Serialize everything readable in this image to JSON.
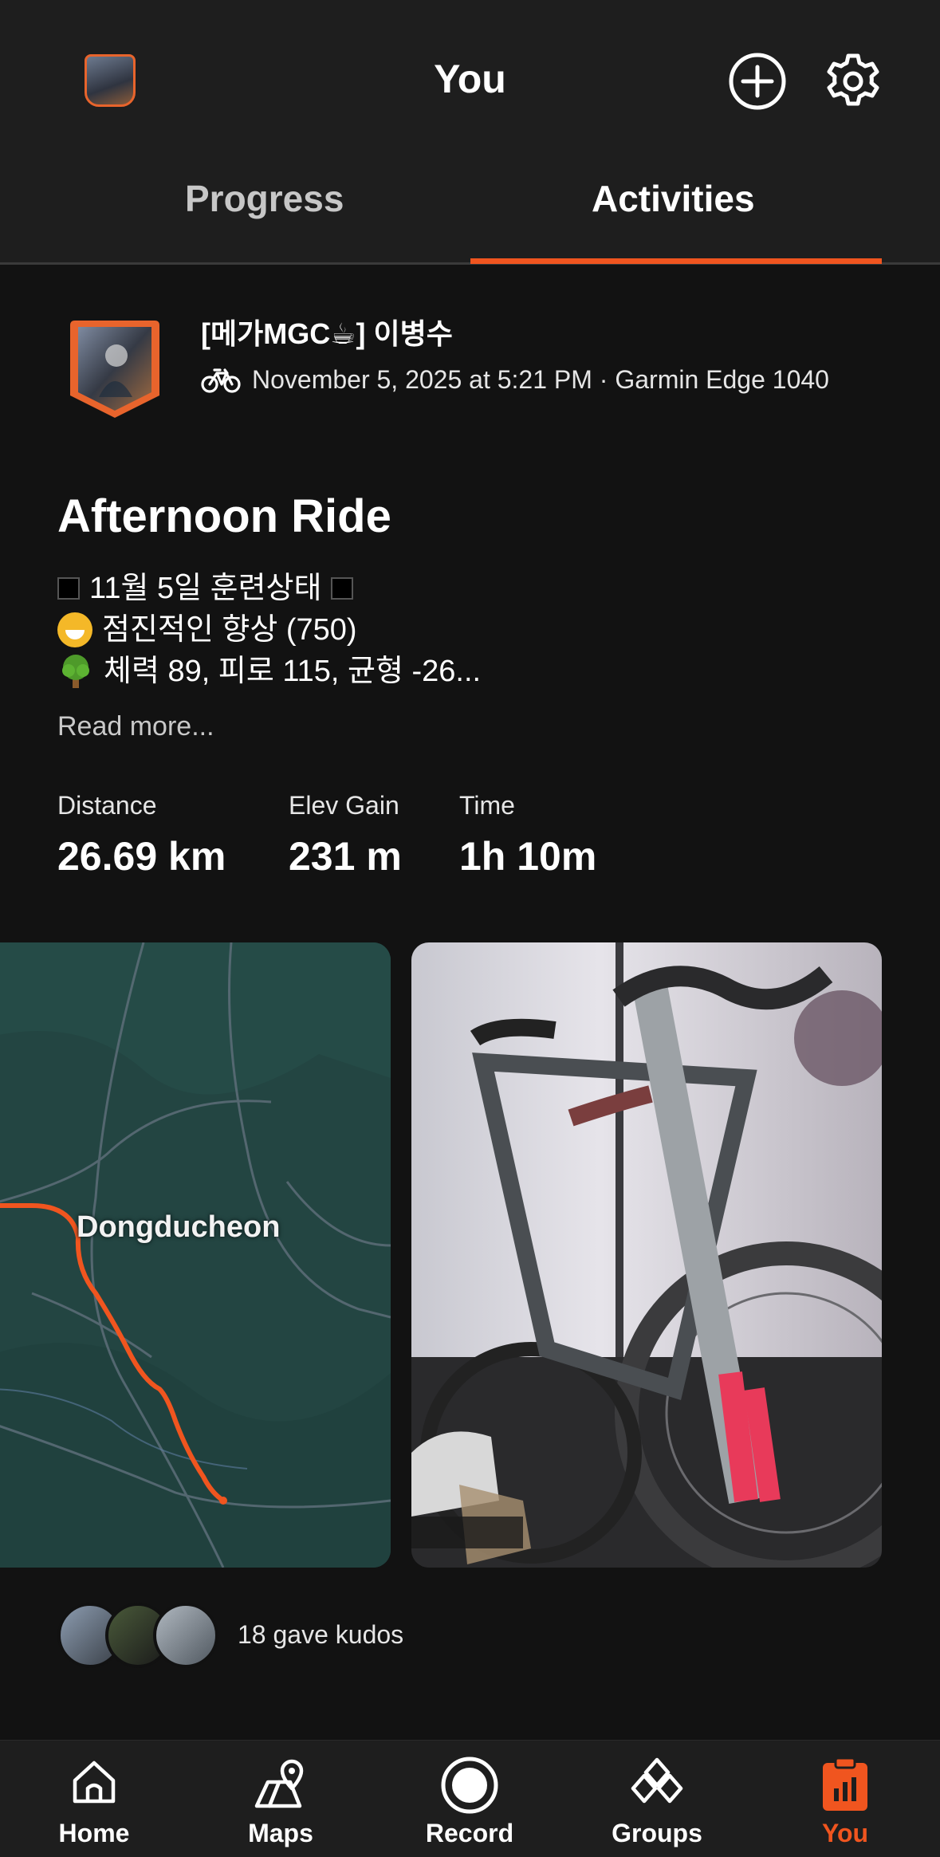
{
  "header": {
    "title": "You",
    "tabs": [
      {
        "label": "Progress",
        "active": false
      },
      {
        "label": "Activities",
        "active": true
      }
    ],
    "accent_color": "#f0551f"
  },
  "activity": {
    "athlete_name": "[메가MGC☕] 이병수",
    "meta": "November 5, 2025 at 5:21 PM · Garmin Edge 1040",
    "sport_icon": "bike-icon",
    "title": "Afternoon Ride",
    "description_lines": [
      "11월 5일 훈련상태",
      "점진적인 향상 (750)",
      "체력 89, 피로 115, 균형 -26..."
    ],
    "read_more": "Read more...",
    "stats": [
      {
        "label": "Distance",
        "value": "26.69 km"
      },
      {
        "label": "Elev Gain",
        "value": "231 m"
      },
      {
        "label": "Time",
        "value": "1h 10m"
      }
    ],
    "map_label": "Dongducheon",
    "kudos_text": "18 gave kudos"
  },
  "nav": {
    "items": [
      {
        "label": "Home",
        "icon": "home-icon",
        "active": false
      },
      {
        "label": "Maps",
        "icon": "maps-icon",
        "active": false
      },
      {
        "label": "Record",
        "icon": "record-icon",
        "active": false
      },
      {
        "label": "Groups",
        "icon": "groups-icon",
        "active": false
      },
      {
        "label": "You",
        "icon": "you-icon",
        "active": true
      }
    ]
  }
}
